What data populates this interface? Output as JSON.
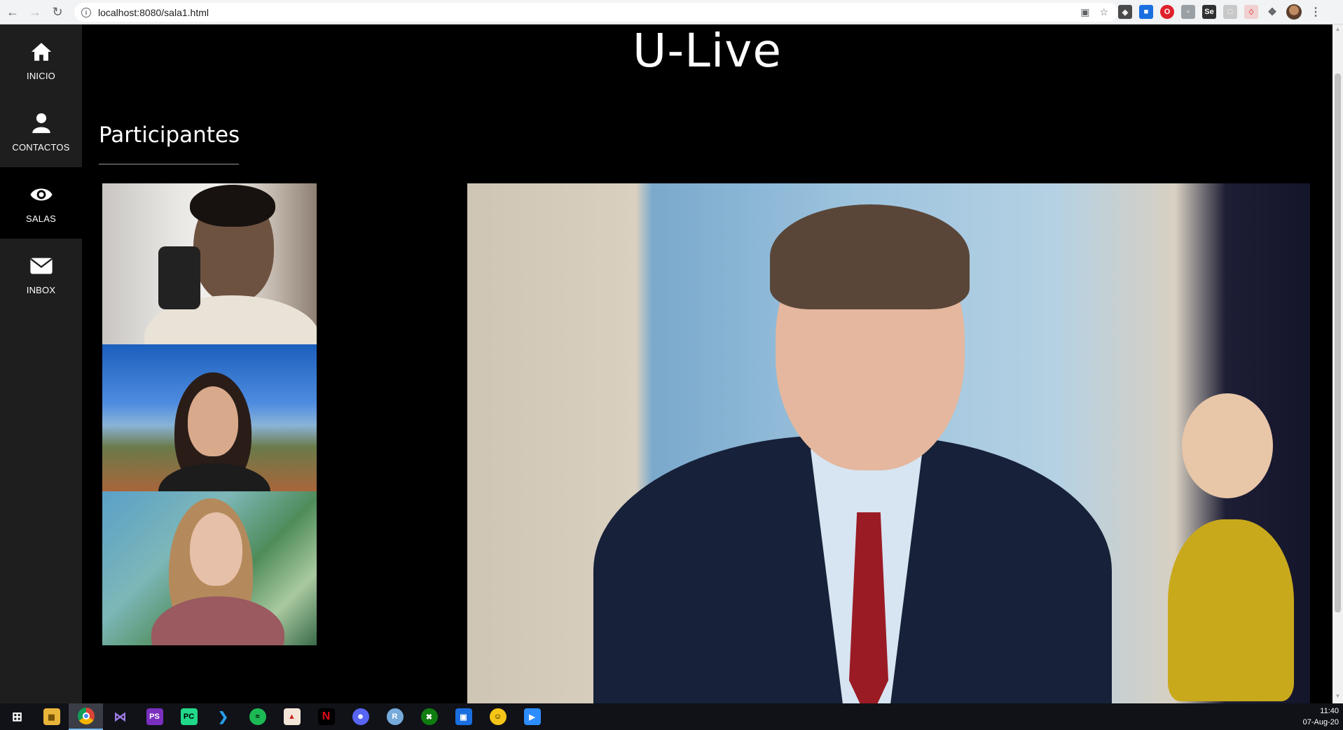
{
  "browser": {
    "url": "localhost:8080/sala1.html",
    "back_icon": "arrow-left-icon",
    "forward_icon": "arrow-right-icon",
    "reload_icon": "reload-icon"
  },
  "sidebar": {
    "items": [
      {
        "label": "INICIO",
        "icon": "home-icon",
        "active": false
      },
      {
        "label": "CONTACTOS",
        "icon": "person-icon",
        "active": false
      },
      {
        "label": "SALAS",
        "icon": "eye-icon",
        "active": true
      },
      {
        "label": "INBOX",
        "icon": "envelope-icon",
        "active": false
      }
    ]
  },
  "header": {
    "brand": "U-Live"
  },
  "participants": {
    "title": "Participantes",
    "thumbnails": [
      "participant-video-1",
      "participant-video-2",
      "participant-video-3"
    ]
  },
  "main_video": {
    "name": "main-speaker-video"
  },
  "taskbar": {
    "apps": [
      "windows-start",
      "file-explorer",
      "chrome",
      "visual-studio",
      "phpstorm",
      "pycharm",
      "vscode",
      "spotify",
      "popcorn-time",
      "netflix",
      "discord",
      "r-studio",
      "xbox",
      "remote-desktop",
      "emoji-app",
      "zoom"
    ],
    "time": "11:40",
    "date": "07-Aug-20"
  },
  "colors": {
    "page_bg": "#000000",
    "sidebar_bg": "#1e1e1e",
    "text": "#ffffff"
  }
}
